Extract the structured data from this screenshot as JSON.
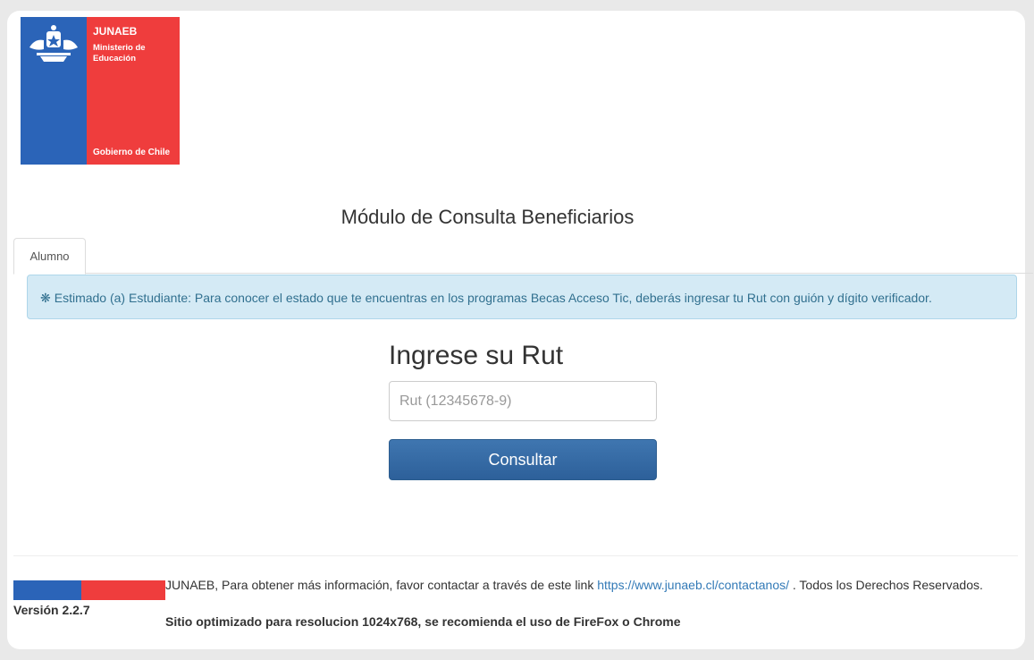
{
  "logo": {
    "brand": "JUNAEB",
    "ministry": "Ministerio de Educación",
    "government": "Gobierno de Chile",
    "emblem_icon": "chile-coat-of-arms-icon",
    "colors": {
      "blue": "#2b64b8",
      "red": "#ef3d3d"
    }
  },
  "page": {
    "title": "Módulo de Consulta Beneficiarios"
  },
  "tabs": [
    {
      "label": "Alumno",
      "active": true
    }
  ],
  "alert": {
    "icon": "asterisk-icon",
    "text": "Estimado (a) Estudiante: Para conocer el estado que te encuentras en los programas Becas Acceso Tic, deberás ingresar tu Rut con guión y dígito verificador."
  },
  "form": {
    "heading": "Ingrese su Rut",
    "rut_placeholder": "Rut (12345678-9)",
    "rut_value": "",
    "submit_label": "Consultar"
  },
  "footer": {
    "text_before_link": "JUNAEB, Para obtener más información, favor contactar a través de este link ",
    "link_text": "https://www.junaeb.cl/contactanos/",
    "text_after_link": " . Todos los Derechos Reservados.",
    "version": "Versión 2.2.7",
    "optimized_note": "Sitio optimizado para resolucion 1024x768, se recomienda el uso de FireFox o Chrome"
  }
}
